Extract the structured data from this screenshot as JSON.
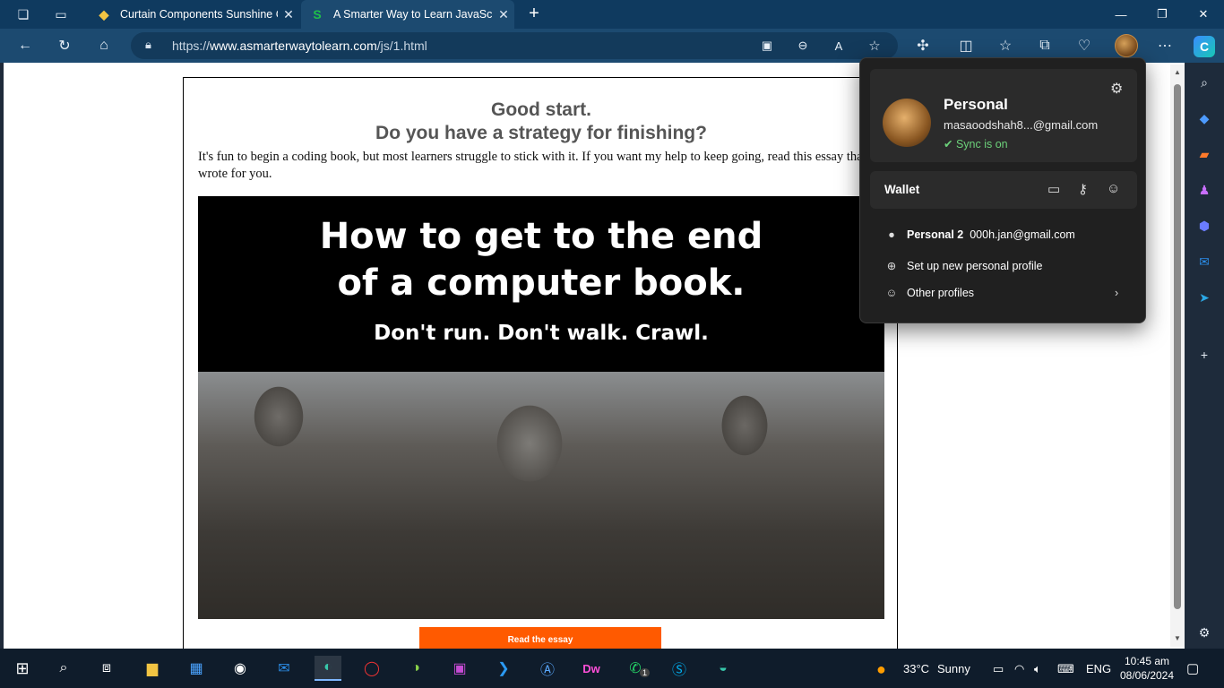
{
  "tabs": [
    {
      "title": "Curtain Components Sunshine C",
      "active": false
    },
    {
      "title": "A Smarter Way to Learn JavaScrip",
      "active": true
    }
  ],
  "address": {
    "prefix": "https://",
    "domain": "www.asmarterwaytolearn.com",
    "path": "/js/1.html"
  },
  "page": {
    "heading_line1": "Good start.",
    "heading_line2": "Do you have a strategy for finishing?",
    "intro": "It's fun to begin a coding book, but most learners struggle to stick with it. If you want my help to keep going, read this essay that I wrote for you.",
    "banner_line1": "How to get to the end",
    "banner_line2": "of a computer book.",
    "banner_line3": "Don't run. Don't walk. Crawl.",
    "cta": "Read the essay"
  },
  "profile": {
    "name": "Personal",
    "email": "masaoodshah8...@gmail.com",
    "sync": "Sync is on",
    "wallet": "Wallet",
    "other_profile_name": "Personal 2",
    "other_profile_email": "000h.jan@gmail.com",
    "new_profile": "Set up new personal profile",
    "other_profiles": "Other profiles"
  },
  "taskbar": {
    "temperature": "33°C",
    "weather": "Sunny",
    "lang": "ENG",
    "time": "10:45 am",
    "date": "08/06/2024",
    "whatsapp_badge": "1"
  },
  "colors": {
    "cta": "#ff5a00",
    "sync": "#6cd17a",
    "titlebar": "#0f3a5f"
  }
}
